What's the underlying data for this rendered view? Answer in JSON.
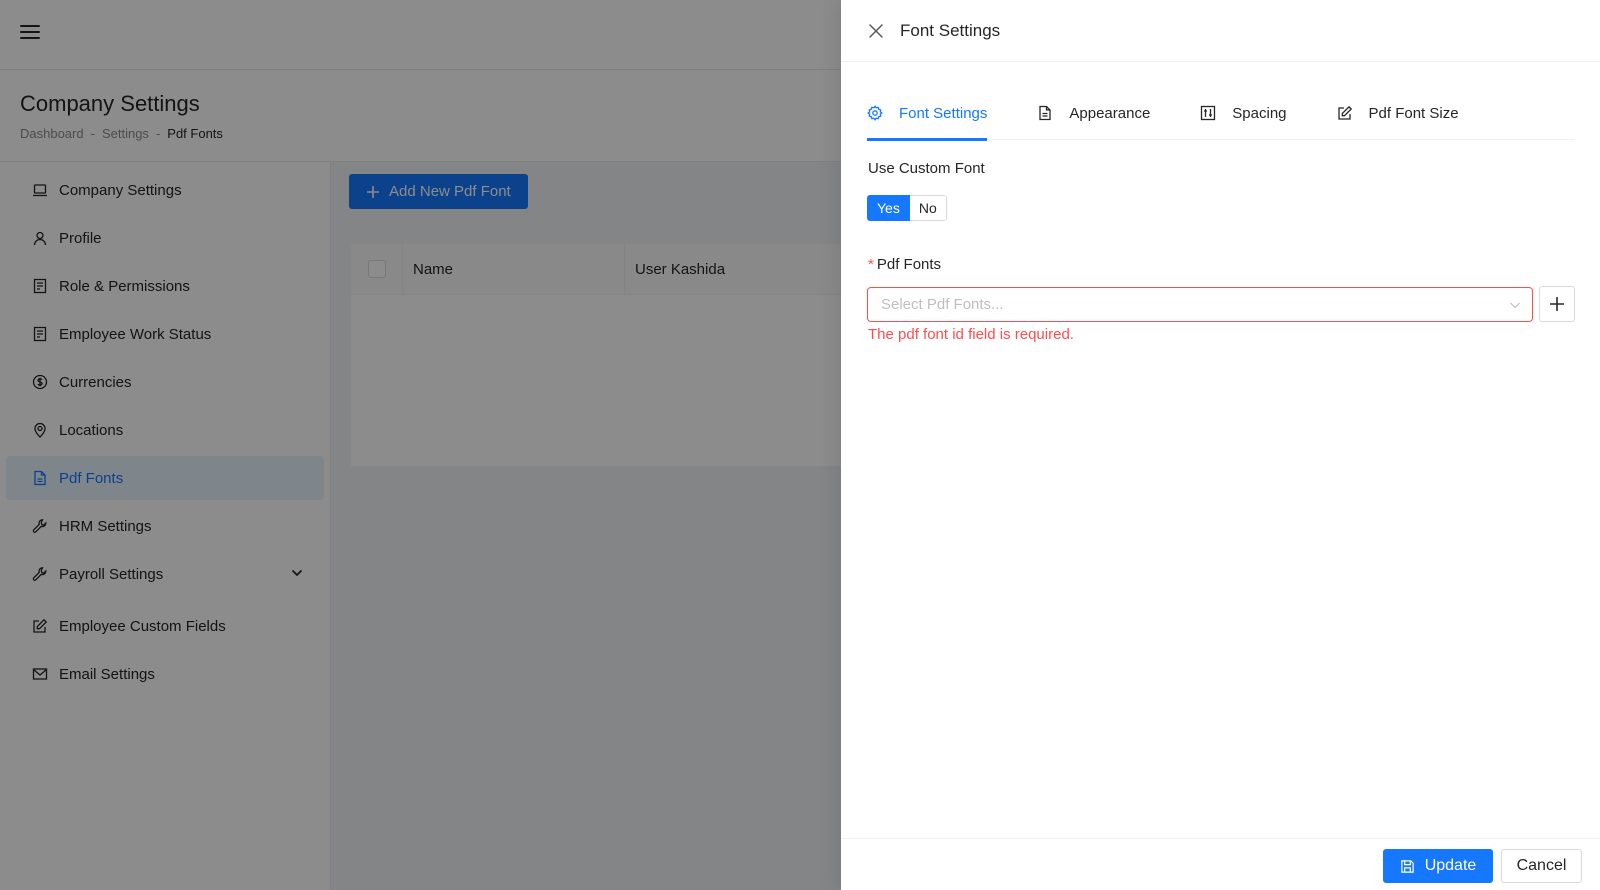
{
  "page": {
    "title": "Company Settings",
    "breadcrumb": [
      "Dashboard",
      "Settings",
      "Pdf Fonts"
    ]
  },
  "sidebar": {
    "items": [
      {
        "label": "Company Settings",
        "icon": "laptop-icon"
      },
      {
        "label": "Profile",
        "icon": "user-icon"
      },
      {
        "label": "Role & Permissions",
        "icon": "document-icon"
      },
      {
        "label": "Employee Work Status",
        "icon": "document-icon"
      },
      {
        "label": "Currencies",
        "icon": "dollar-icon"
      },
      {
        "label": "Locations",
        "icon": "location-pin-icon"
      },
      {
        "label": "Pdf Fonts",
        "icon": "file-pdf-icon",
        "active": true
      },
      {
        "label": "HRM Settings",
        "icon": "tool-icon"
      },
      {
        "label": "Payroll Settings",
        "icon": "tool-icon",
        "expandable": true
      },
      {
        "label": "Employee Custom Fields",
        "icon": "edit-icon"
      },
      {
        "label": "Email Settings",
        "icon": "mail-icon"
      }
    ]
  },
  "content": {
    "add_button": "Add New Pdf Font",
    "table": {
      "columns": [
        "Name",
        "User Kashida"
      ]
    }
  },
  "drawer": {
    "title": "Font Settings",
    "tabs": [
      {
        "label": "Font Settings",
        "icon": "gear-icon",
        "active": true
      },
      {
        "label": "Appearance",
        "icon": "file-icon"
      },
      {
        "label": "Spacing",
        "icon": "sliders-icon"
      },
      {
        "label": "Pdf Font Size",
        "icon": "edit-icon"
      }
    ],
    "custom_font": {
      "label": "Use Custom Font",
      "options": [
        "Yes",
        "No"
      ],
      "selected": "Yes"
    },
    "pdf_fonts": {
      "required_mark": "*",
      "label": "Pdf Fonts",
      "placeholder": "Select Pdf Fonts...",
      "error": "The pdf font id field is required."
    },
    "footer": {
      "update": "Update",
      "cancel": "Cancel"
    }
  },
  "colors": {
    "primary": "#1677ff",
    "error": "#ff4d4f",
    "active_bg": "#e6f4ff"
  }
}
